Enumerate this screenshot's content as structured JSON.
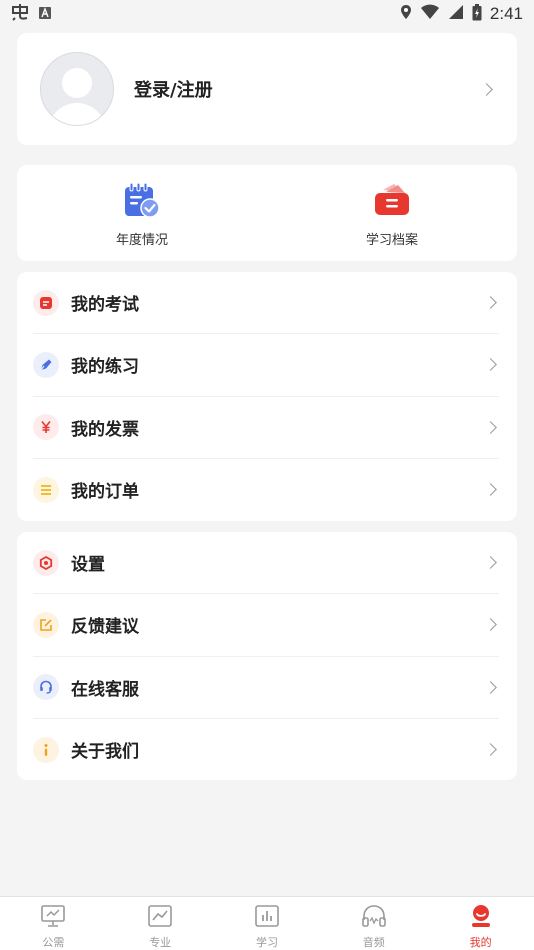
{
  "status_bar": {
    "time": "2:41"
  },
  "profile": {
    "login_label": "登录/注册"
  },
  "shortcuts": [
    {
      "label": "年度情况",
      "icon": "calendar-check-icon"
    },
    {
      "label": "学习档案",
      "icon": "archive-box-icon"
    }
  ],
  "menu_group_1": [
    {
      "label": "我的考试",
      "icon": "exam-icon",
      "color": "#e8372f"
    },
    {
      "label": "我的练习",
      "icon": "pen-icon",
      "color": "#4a6fe3"
    },
    {
      "label": "我的发票",
      "icon": "yen-icon",
      "color": "#e8372f"
    },
    {
      "label": "我的订单",
      "icon": "list-icon",
      "color": "#f2b418"
    }
  ],
  "menu_group_2": [
    {
      "label": "设置",
      "icon": "settings-icon",
      "color": "#e8372f"
    },
    {
      "label": "反馈建议",
      "icon": "edit-icon",
      "color": "#f2a218"
    },
    {
      "label": "在线客服",
      "icon": "headset-icon",
      "color": "#4a6fe3"
    },
    {
      "label": "关于我们",
      "icon": "info-icon",
      "color": "#f2a218"
    }
  ],
  "tabs": [
    {
      "label": "公需",
      "icon": "presentation-icon"
    },
    {
      "label": "专业",
      "icon": "chart-line-icon"
    },
    {
      "label": "学习",
      "icon": "bar-chart-icon"
    },
    {
      "label": "音频",
      "icon": "headphones-icon"
    },
    {
      "label": "我的",
      "icon": "profile-icon",
      "active": true
    }
  ],
  "colors": {
    "accent": "#e8372f",
    "background": "#f4f4f5",
    "card": "#ffffff",
    "tab_inactive": "#999999"
  }
}
